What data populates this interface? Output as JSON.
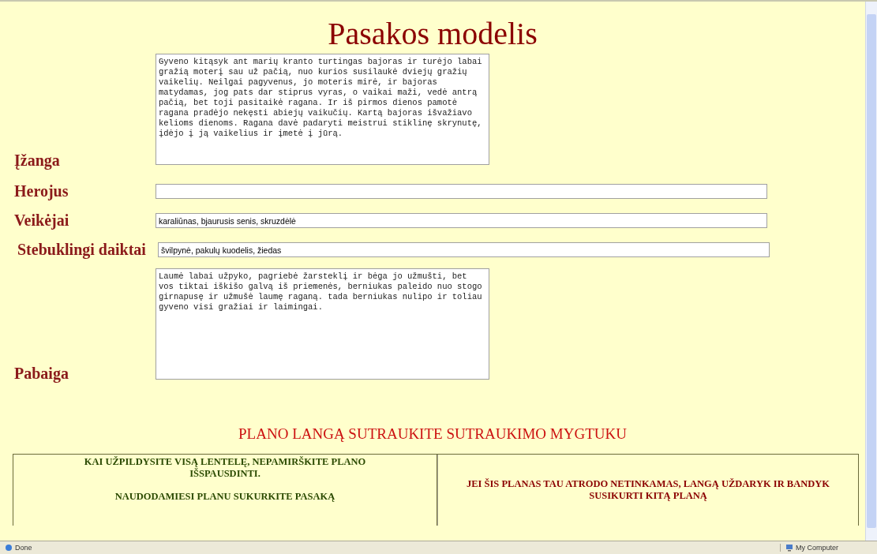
{
  "title": "Pasakos modelis",
  "fields": [
    {
      "kind": "textarea",
      "label": "Įžanga",
      "value": "Gyveno kitąsyk ant marių kranto turtingas bajoras ir turėjo labai gražią moterį sau už pačią, nuo kurios susilaukė dviejų gražių vaikelių. Neilgai pagyvenus, jo moteris mirė, ir bajoras matydamas, jog pats dar stiprus vyras, o vaikai maži, vedė antrą pačią, bet toji pasitaikė ragana. Ir iš pirmos dienos pamotė ragana pradėjo nekęsti abiejų vaikučių. Kartą bajoras išvažiavo kelioms dienoms. Ragana davė padaryti meistrui stiklinę skrynutę, įdėjo į ją vaikelius ir įmetė į jūrą."
    },
    {
      "kind": "input",
      "label": "Herojus"
    },
    {
      "kind": "input",
      "label": "Veikėjai",
      "value": "karaliūnas, bjaurusis senis, skruzdėlė"
    },
    {
      "kind": "input",
      "label": "Stebuklingi daiktai",
      "value": "švilpynė, pakulų kuodelis, žiedas"
    },
    {
      "kind": "textarea",
      "label": "Pabaiga",
      "value": "Laumė labai užpyko, pagriebė žarsteklį ir bėga jo užmušti, bet vos tiktai iškišo galvą iš priemenės, berniukas paleido nuo stogo girnapusę ir užmušė laumę raganą. tada berniukas nulipo ir toliau gyveno visi gražiai ir laimingai."
    }
  ],
  "instruction": "PLANO LANGĄ SUTRAUKITE SUTRAUKIMO MYGTUKU",
  "table": {
    "left": [
      "KAI UŽPILDYSITE VISĄ LENTELĘ, NEPAMIRŠKITE PLANO IŠSPAUSDINTI.",
      "NAUDODAMIESI PLANU SUKURKITE PASAKĄ"
    ],
    "right": "JEI ŠIS PLANAS TAU ATRODO NETINKAMAS, LANGĄ UŽDARYK IR BANDYK SUSIKURTI KITĄ PLANĄ"
  },
  "status_bar": {
    "left": "Done",
    "right": "My Computer"
  }
}
